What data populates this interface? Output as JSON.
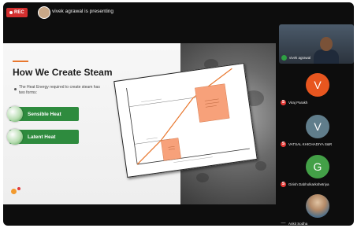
{
  "topbar": {
    "rec_label": "REC",
    "presenter_text": "vivek agrawal is presenting"
  },
  "slide": {
    "title": "How We Create Steam",
    "bullet": "The Heat Energy required to create steam has two forms:",
    "sensible_label": "Sensible Heat",
    "latent_label": "Latent Heat"
  },
  "participants": [
    {
      "name": "vivek agrawal",
      "mic": "on"
    },
    {
      "name": "Viraj Parakh",
      "initial": "V",
      "color": "#e8561f",
      "mic": "off"
    },
    {
      "name": "VATSAL KHICHADIYA S&R",
      "initial": "V",
      "color": "#607d8b",
      "mic": "off"
    },
    {
      "name": "Girish Dabholkarkshetriya",
      "initial": "G",
      "color": "#43a047",
      "mic": "off"
    },
    {
      "name": "Ankit Sodha",
      "mic": "none"
    }
  ],
  "colors": {
    "accent": "#e8772e",
    "heat_green": "#2e8b3e",
    "graph_box": "#f7a17a",
    "graph_line": "#e8772e"
  }
}
